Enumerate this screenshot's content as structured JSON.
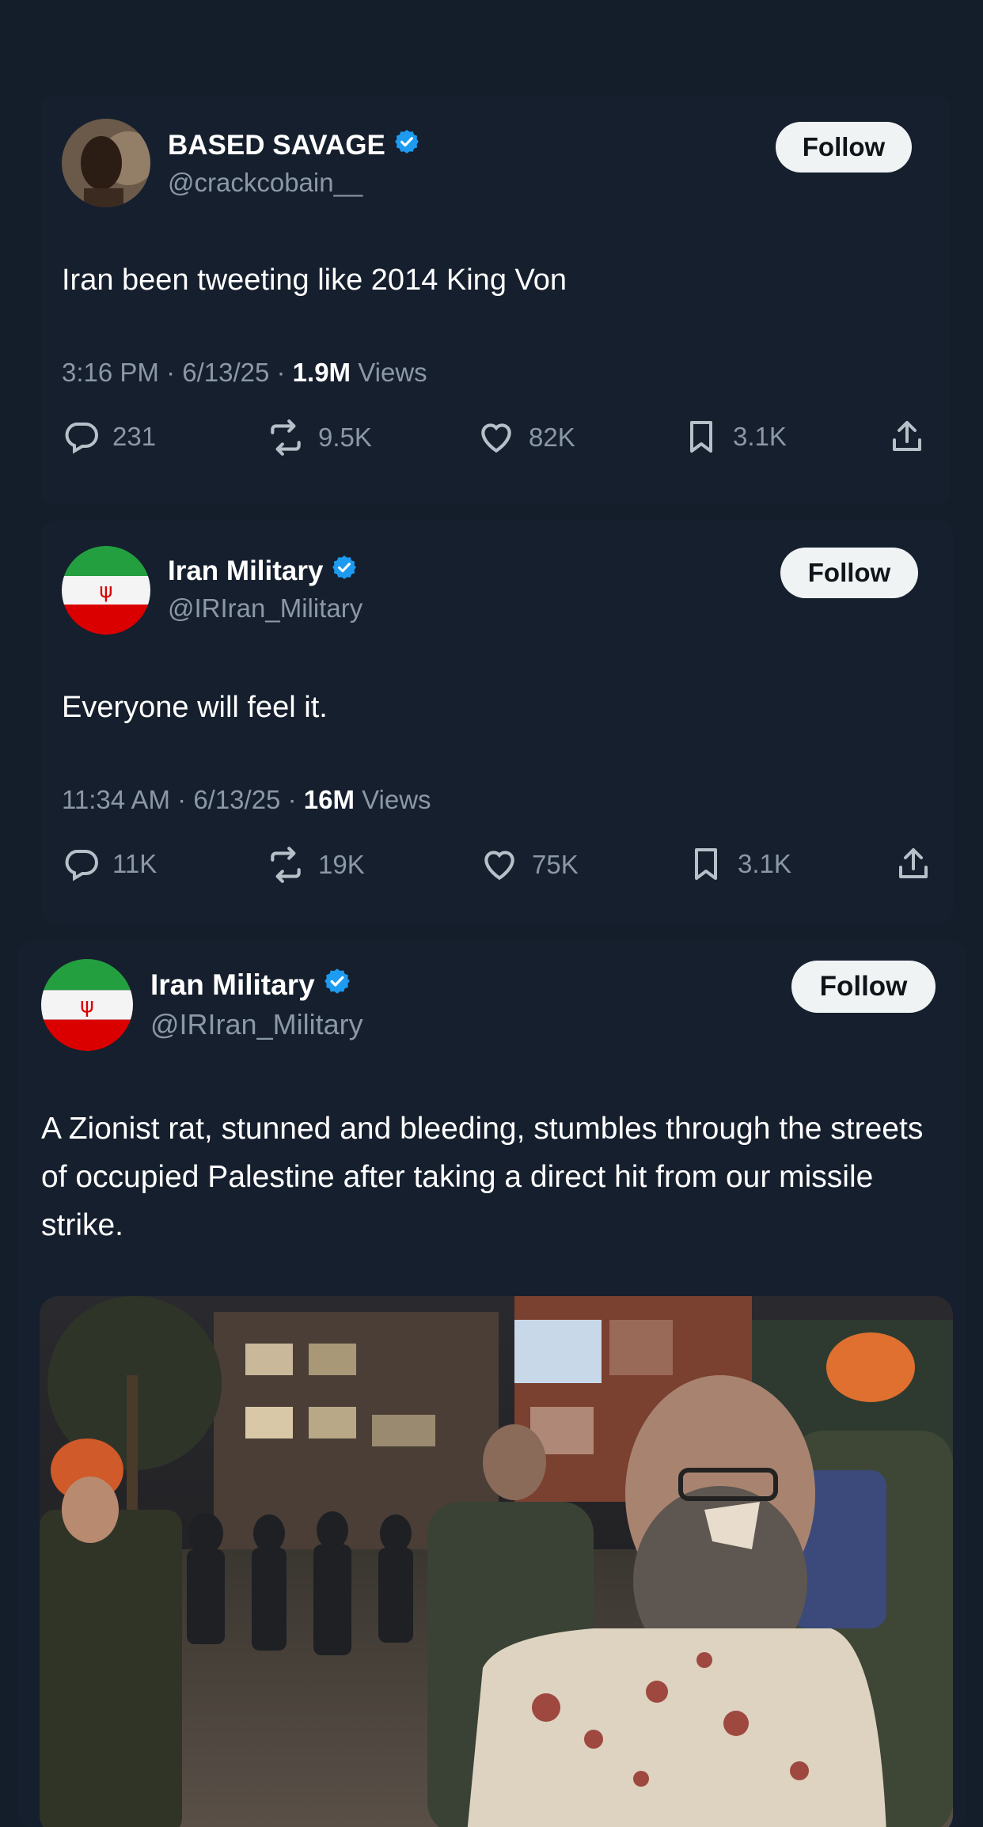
{
  "tweets": [
    {
      "display_name": "BASED SAVAGE",
      "handle": "@crackcobain__",
      "follow_label": "Follow",
      "text": "Iran been tweeting like 2014 King Von",
      "time": "3:16 PM",
      "date": "6/13/25",
      "views_count": "1.9M",
      "views_label": "Views",
      "replies": "231",
      "reposts": "9.5K",
      "likes": "82K",
      "bookmarks": "3.1K"
    },
    {
      "display_name": "Iran Military",
      "handle": "@IRIran_Military",
      "follow_label": "Follow",
      "text": "Everyone will feel it.",
      "time": "11:34 AM",
      "date": "6/13/25",
      "views_count": "16M",
      "views_label": "Views",
      "replies": "11K",
      "reposts": "19K",
      "likes": "75K",
      "bookmarks": "3.1K"
    },
    {
      "display_name": "Iran Military",
      "handle": "@IRIran_Military",
      "follow_label": "Follow",
      "text": "A Zionist rat, stunned and bleeding, stumbles through the streets of occupied Palestine after taking a direct hit from our missile strike."
    }
  ],
  "colors": {
    "background": "#141d2a",
    "verified_blue": "#1d9bf0",
    "muted_text": "#8b98a5",
    "follow_button": "#eff3f4"
  },
  "icons": [
    "verified-badge-icon",
    "reply-icon",
    "repost-icon",
    "like-icon",
    "bookmark-icon",
    "share-icon"
  ]
}
